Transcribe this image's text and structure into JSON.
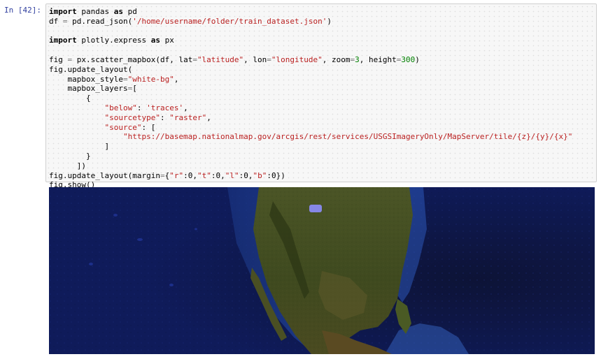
{
  "cell": {
    "prompt": "In [42]:",
    "code": [
      [
        {
          "t": "import",
          "c": "kw"
        },
        {
          "t": " pandas "
        },
        {
          "t": "as",
          "c": "kw"
        },
        {
          "t": " pd"
        }
      ],
      [
        {
          "t": "df "
        },
        {
          "t": "=",
          "c": "op"
        },
        {
          "t": " pd.read_json("
        },
        {
          "t": "'/home/username/folder/train_dataset.json'",
          "c": "str"
        },
        {
          "t": ")"
        }
      ],
      [],
      [
        {
          "t": "import",
          "c": "kw"
        },
        {
          "t": " plotly.express "
        },
        {
          "t": "as",
          "c": "kw"
        },
        {
          "t": " px"
        }
      ],
      [],
      [
        {
          "t": "fig "
        },
        {
          "t": "=",
          "c": "op"
        },
        {
          "t": " px.scatter_mapbox(df, lat"
        },
        {
          "t": "=",
          "c": "op"
        },
        {
          "t": "\"latitude\"",
          "c": "str"
        },
        {
          "t": ", lon"
        },
        {
          "t": "=",
          "c": "op"
        },
        {
          "t": "\"longitude\"",
          "c": "str"
        },
        {
          "t": ", zoom"
        },
        {
          "t": "=",
          "c": "op"
        },
        {
          "t": "3",
          "c": "num"
        },
        {
          "t": ", height"
        },
        {
          "t": "=",
          "c": "op"
        },
        {
          "t": "300",
          "c": "num"
        },
        {
          "t": ")"
        }
      ],
      [
        {
          "t": "fig.update_layout("
        }
      ],
      [
        {
          "t": "    mapbox_style"
        },
        {
          "t": "=",
          "c": "op"
        },
        {
          "t": "\"white-bg\"",
          "c": "str"
        },
        {
          "t": ","
        }
      ],
      [
        {
          "t": "    mapbox_layers"
        },
        {
          "t": "=",
          "c": "op"
        },
        {
          "t": "["
        }
      ],
      [
        {
          "t": "        {"
        }
      ],
      [
        {
          "t": "            "
        },
        {
          "t": "\"below\"",
          "c": "str"
        },
        {
          "t": ": "
        },
        {
          "t": "'traces'",
          "c": "str"
        },
        {
          "t": ","
        }
      ],
      [
        {
          "t": "            "
        },
        {
          "t": "\"sourcetype\"",
          "c": "str"
        },
        {
          "t": ": "
        },
        {
          "t": "\"raster\"",
          "c": "str"
        },
        {
          "t": ","
        }
      ],
      [
        {
          "t": "            "
        },
        {
          "t": "\"source\"",
          "c": "str"
        },
        {
          "t": ": ["
        }
      ],
      [
        {
          "t": "                "
        },
        {
          "t": "\"https://basemap.nationalmap.gov/arcgis/rest/services/USGSImageryOnly/MapServer/tile/{z}/{y}/{x}\"",
          "c": "str"
        }
      ],
      [
        {
          "t": "            ]"
        }
      ],
      [
        {
          "t": "        }"
        }
      ],
      [
        {
          "t": "      ])"
        }
      ],
      [
        {
          "t": "fig.update_layout(margin"
        },
        {
          "t": "=",
          "c": "op"
        },
        {
          "t": "{"
        },
        {
          "t": "\"r\"",
          "c": "str"
        },
        {
          "t": ":0,"
        },
        {
          "t": "\"t\"",
          "c": "str"
        },
        {
          "t": ":0,"
        },
        {
          "t": "\"l\"",
          "c": "str"
        },
        {
          "t": ":0,"
        },
        {
          "t": "\"b\"",
          "c": "str"
        },
        {
          "t": ":0})"
        }
      ],
      [
        {
          "t": "fig.show()"
        }
      ]
    ]
  },
  "output": {
    "map_style": "satellite-imagery",
    "colors": {
      "ocean": "#0f1b5a",
      "land": "#3d4a1f",
      "marker": "#8a8af0"
    }
  }
}
